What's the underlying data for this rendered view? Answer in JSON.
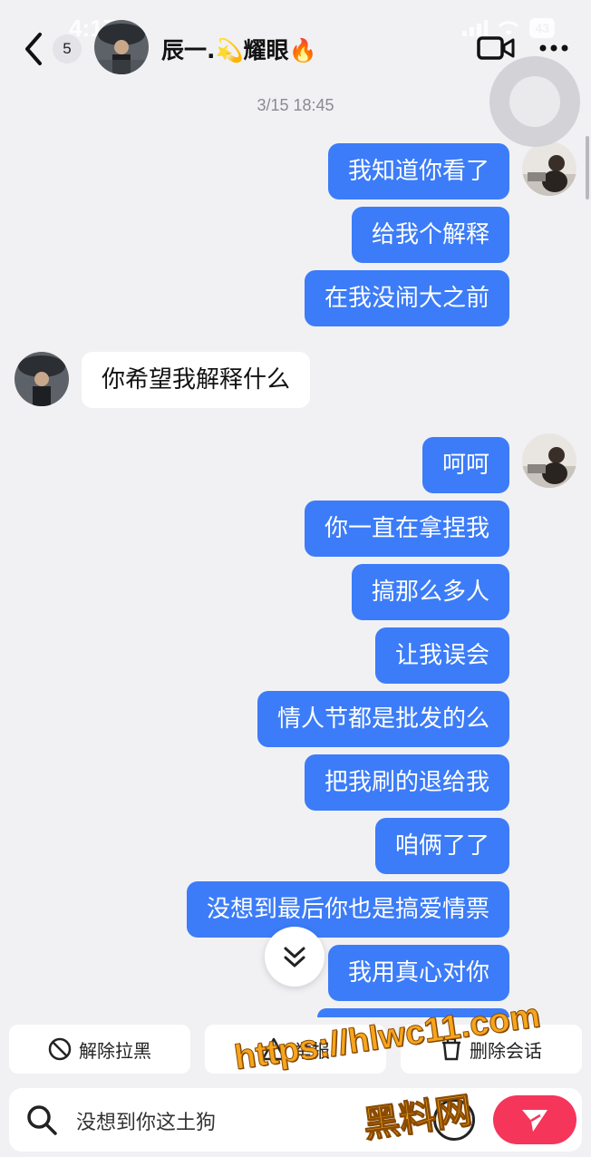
{
  "status_bar": {
    "time": "4:17",
    "battery": "43"
  },
  "header": {
    "unread_count": "5",
    "contact_name": "辰一.💫耀眼🔥"
  },
  "timestamp": "3/15 18:45",
  "messages": [
    {
      "side": "out",
      "text": "我知道你看了"
    },
    {
      "side": "out",
      "text": "给我个解释"
    },
    {
      "side": "out",
      "text": "在我没闹大之前"
    },
    {
      "side": "in",
      "text": "你希望我解释什么"
    },
    {
      "side": "out",
      "text": "呵呵"
    },
    {
      "side": "out",
      "text": "你一直在拿捏我"
    },
    {
      "side": "out",
      "text": "搞那么多人"
    },
    {
      "side": "out",
      "text": "让我误会"
    },
    {
      "side": "out",
      "text": "情人节都是批发的么"
    },
    {
      "side": "out",
      "text": "把我刷的退给我"
    },
    {
      "side": "out",
      "text": "咱俩了了"
    },
    {
      "side": "out",
      "text": "没想到最后你也是搞爱情票"
    },
    {
      "side": "out",
      "text": "我用真心对你"
    }
  ],
  "actions": {
    "unblock_label": "解除拉黑",
    "report_label": "举报",
    "delete_label": "删除会话"
  },
  "input": {
    "draft": "没想到你这土狗"
  },
  "watermark": {
    "url": "https://hlwc11.com",
    "name": "黑料网"
  },
  "colors": {
    "outgoing_bubble": "#3c7cf8",
    "incoming_bubble": "#ffffff",
    "send_button": "#f5355a",
    "background": "#f1f1f4"
  }
}
